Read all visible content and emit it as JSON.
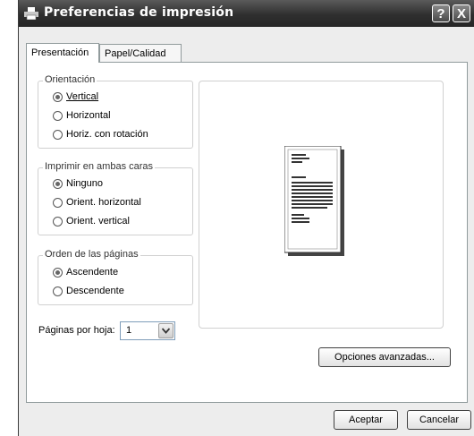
{
  "window": {
    "title": "Preferencias de impresión",
    "help_label": "?",
    "close_label": "X"
  },
  "tabs": [
    {
      "label": "Presentación",
      "active": true
    },
    {
      "label": "Papel/Calidad",
      "active": false
    }
  ],
  "orientation": {
    "title": "Orientación",
    "options": [
      {
        "label": "Vertical",
        "selected": true
      },
      {
        "label": "Horizontal",
        "selected": false
      },
      {
        "label": "Horiz. con rotación",
        "selected": false
      }
    ]
  },
  "duplex": {
    "title": "Imprimir en ambas caras",
    "options": [
      {
        "label": "Ninguno",
        "selected": true
      },
      {
        "label": "Orient. horizontal",
        "selected": false
      },
      {
        "label": "Orient. vertical",
        "selected": false
      }
    ]
  },
  "page_order": {
    "title": "Orden de las páginas",
    "options": [
      {
        "label": "Ascendente",
        "selected": true
      },
      {
        "label": "Descendente",
        "selected": false
      }
    ]
  },
  "pages_per_sheet": {
    "label": "Páginas por hoja:",
    "value": "1"
  },
  "buttons": {
    "advanced": "Opciones avanzadas...",
    "ok": "Aceptar",
    "cancel": "Cancelar"
  },
  "icons": {
    "title": "printer-icon",
    "dropdown": "chevron-down-icon"
  }
}
